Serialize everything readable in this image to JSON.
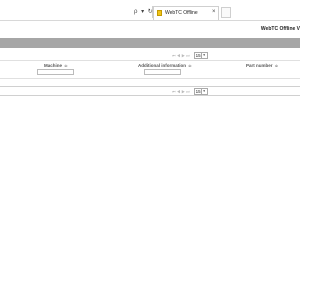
{
  "browser": {
    "address_buttons": "ρ ▾ ↻",
    "tab_label": "WebTC Offline",
    "tab_close": "×"
  },
  "app": {
    "title": "WebTC Offline V"
  },
  "pager": {
    "controls": "⏮ ◀ ▶ ⏭",
    "page_size": "15",
    "select_arrow": "▾"
  },
  "table": {
    "columns": [
      {
        "label": "Machine",
        "sort": "≑"
      },
      {
        "label": "Additional information",
        "sort": "≑"
      },
      {
        "label": "Part number",
        "sort": "≑"
      }
    ],
    "filters": [
      {
        "value": ""
      },
      {
        "value": ""
      }
    ]
  },
  "footer": {
    "pager": {
      "controls": "⏮ ◀ ▶ ⏭",
      "page_size": "15",
      "select_arrow": "▾"
    }
  }
}
